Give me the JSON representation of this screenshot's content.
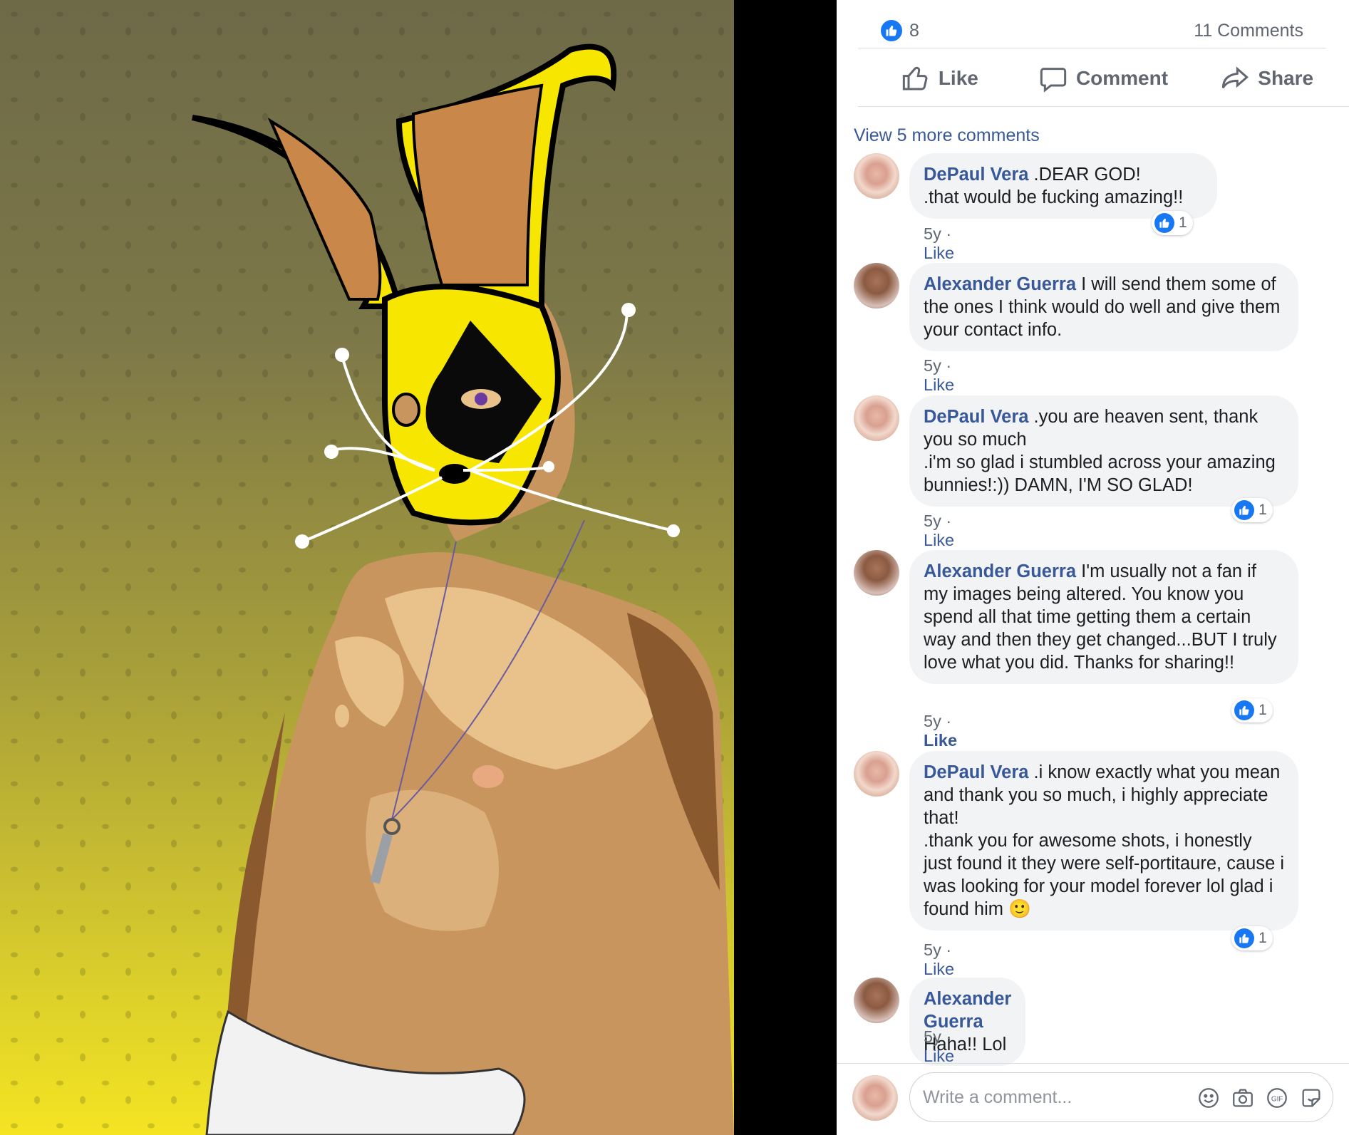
{
  "post": {
    "likes": "8",
    "comments_count": "11 Comments"
  },
  "actions": {
    "like": "Like",
    "comment": "Comment",
    "share": "Share"
  },
  "view_more": "View 5 more comments",
  "comments": [
    {
      "author": "DePaul Vera",
      "text": ".DEAR GOD!\n.that would be fucking amazing!!",
      "time": "5y",
      "like_label": "Like",
      "reactions": "1"
    },
    {
      "author": "Alexander Guerra",
      "text": "I will send them some of the ones I think would do well and give them your contact info.",
      "time": "5y",
      "like_label": "Like"
    },
    {
      "author": "DePaul Vera",
      "text": ".you are heaven sent, thank you so much\n.i'm so glad i stumbled across your amazing bunnies!:)) DAMN, I'M SO GLAD!",
      "time": "5y",
      "like_label": "Like",
      "reactions": "1"
    },
    {
      "author": "Alexander Guerra",
      "text": "I'm usually not a fan if my images being altered. You know you spend all that time getting them a certain way and then they get changed...BUT I truly love what you did. Thanks for sharing!!",
      "time": "5y",
      "like_label": "Like",
      "reactions": "1"
    },
    {
      "author": "DePaul Vera",
      "text": ".i know exactly what you mean and thank you so much, i highly appreciate that!\n.thank you for awesome shots, i honestly just found it they were self-portitaure, cause i was looking for your model forever lol glad i found him 🙂",
      "time": "5y",
      "like_label": "Like",
      "reactions": "1"
    },
    {
      "author": "Alexander Guerra",
      "text": "Haha!! Lol",
      "time": "5y",
      "like_label": "Like"
    }
  ],
  "composer": {
    "placeholder": "Write a comment..."
  },
  "colors": {
    "accent": "#385898",
    "like_blue": "#1877f2",
    "bubble": "#f2f3f5"
  }
}
